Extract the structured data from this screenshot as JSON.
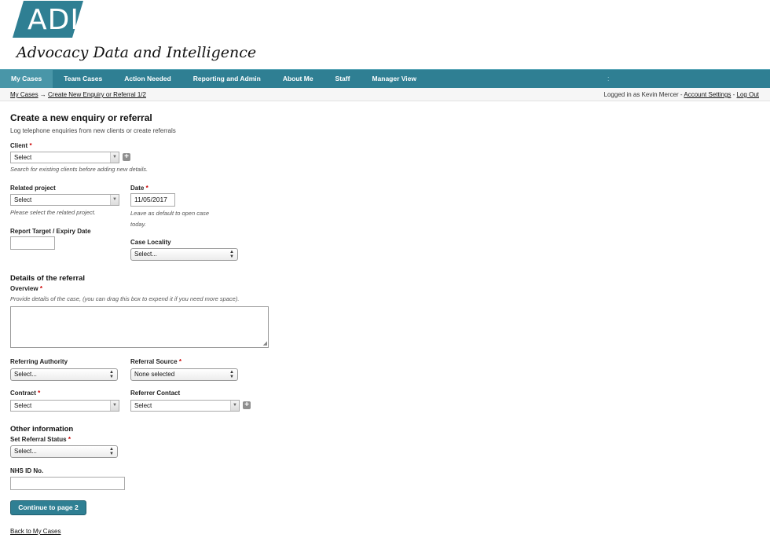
{
  "brand": {
    "logo_text": "ADI",
    "tagline": "Advocacy Data and Intelligence",
    "color": "#2f7f93"
  },
  "nav": {
    "items": [
      {
        "label": "My Cases",
        "active": true
      },
      {
        "label": "Team Cases"
      },
      {
        "label": "Action Needed"
      },
      {
        "label": "Reporting and Admin"
      },
      {
        "label": "About Me"
      },
      {
        "label": "Staff"
      },
      {
        "label": "Manager View"
      }
    ],
    "separator": ":"
  },
  "breadcrumb": {
    "home": "My Cases",
    "arrow": "→",
    "current": "Create New Enquiry or Referral 1/2"
  },
  "user": {
    "logged_in_text": "Logged in as Kevin Mercer - ",
    "account_settings": "Account Settings",
    "dash": " - ",
    "logout": "Log Out"
  },
  "form": {
    "title": "Create a new enquiry or referral",
    "subtitle": "Log telephone enquiries from new clients or create referrals",
    "required_mark": "*",
    "client": {
      "label": "Client",
      "value": "Select",
      "help": "Search for existing clients before adding new details."
    },
    "related_project": {
      "label": "Related project",
      "value": "Select",
      "help": "Please select the related project."
    },
    "date": {
      "label": "Date",
      "value": "11/05/2017",
      "help_line1": "Leave as default to open case",
      "help_line2": "today."
    },
    "report_target": {
      "label": "Report Target / Expiry Date",
      "value": ""
    },
    "case_locality": {
      "label": "Case Locality",
      "value": "Select..."
    },
    "details_section": "Details of the referral",
    "overview": {
      "label": "Overview",
      "help": "Provide details of the case, (you can drag this box to expend it if you need more space)."
    },
    "referring_authority": {
      "label": "Referring Authority",
      "value": "Select..."
    },
    "referral_source": {
      "label": "Referral Source",
      "value": "None selected"
    },
    "contract": {
      "label": "Contract",
      "value": "Select"
    },
    "referrer_contact": {
      "label": "Referrer Contact",
      "value": "Select"
    },
    "other_section": "Other information",
    "referral_status": {
      "label": "Set Referral Status",
      "value": "Select..."
    },
    "nhs_id": {
      "label": "NHS ID No.",
      "value": ""
    },
    "continue_button": "Continue to page 2",
    "back_link": "Back to My Cases"
  },
  "icons": {
    "dropdown_arrow": "▼",
    "updown": "▲▼",
    "plus": "+",
    "resize_grip": "◢"
  }
}
